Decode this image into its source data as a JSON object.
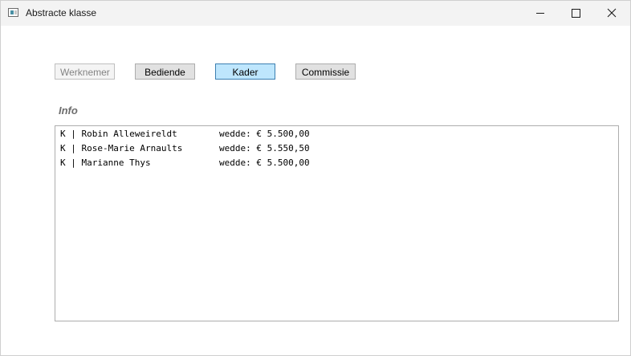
{
  "window": {
    "title": "Abstracte klasse",
    "icon": "app-icon",
    "controls": [
      "minimize-icon",
      "maximize-icon",
      "close-icon"
    ]
  },
  "buttons": {
    "werknemer": {
      "label": "Werknemer",
      "state": "disabled"
    },
    "bediende": {
      "label": "Bediende",
      "state": "normal"
    },
    "kader": {
      "label": "Kader",
      "state": "selected"
    },
    "commissie": {
      "label": "Commissie",
      "state": "normal"
    }
  },
  "info": {
    "label": "Info",
    "items": [
      {
        "text": "K | Robin Alleweireldt",
        "salary": "wedde: € 5.500,00"
      },
      {
        "text": "K | Rose-Marie Arnaults",
        "salary": "wedde: € 5.550,50"
      },
      {
        "text": "K | Marianne Thys",
        "salary": "wedde: € 5.500,00"
      }
    ]
  },
  "colors": {
    "selected_button": "#bee6fd",
    "selected_border": "#3c7fb1",
    "titlebar": "#f3f3f3"
  }
}
